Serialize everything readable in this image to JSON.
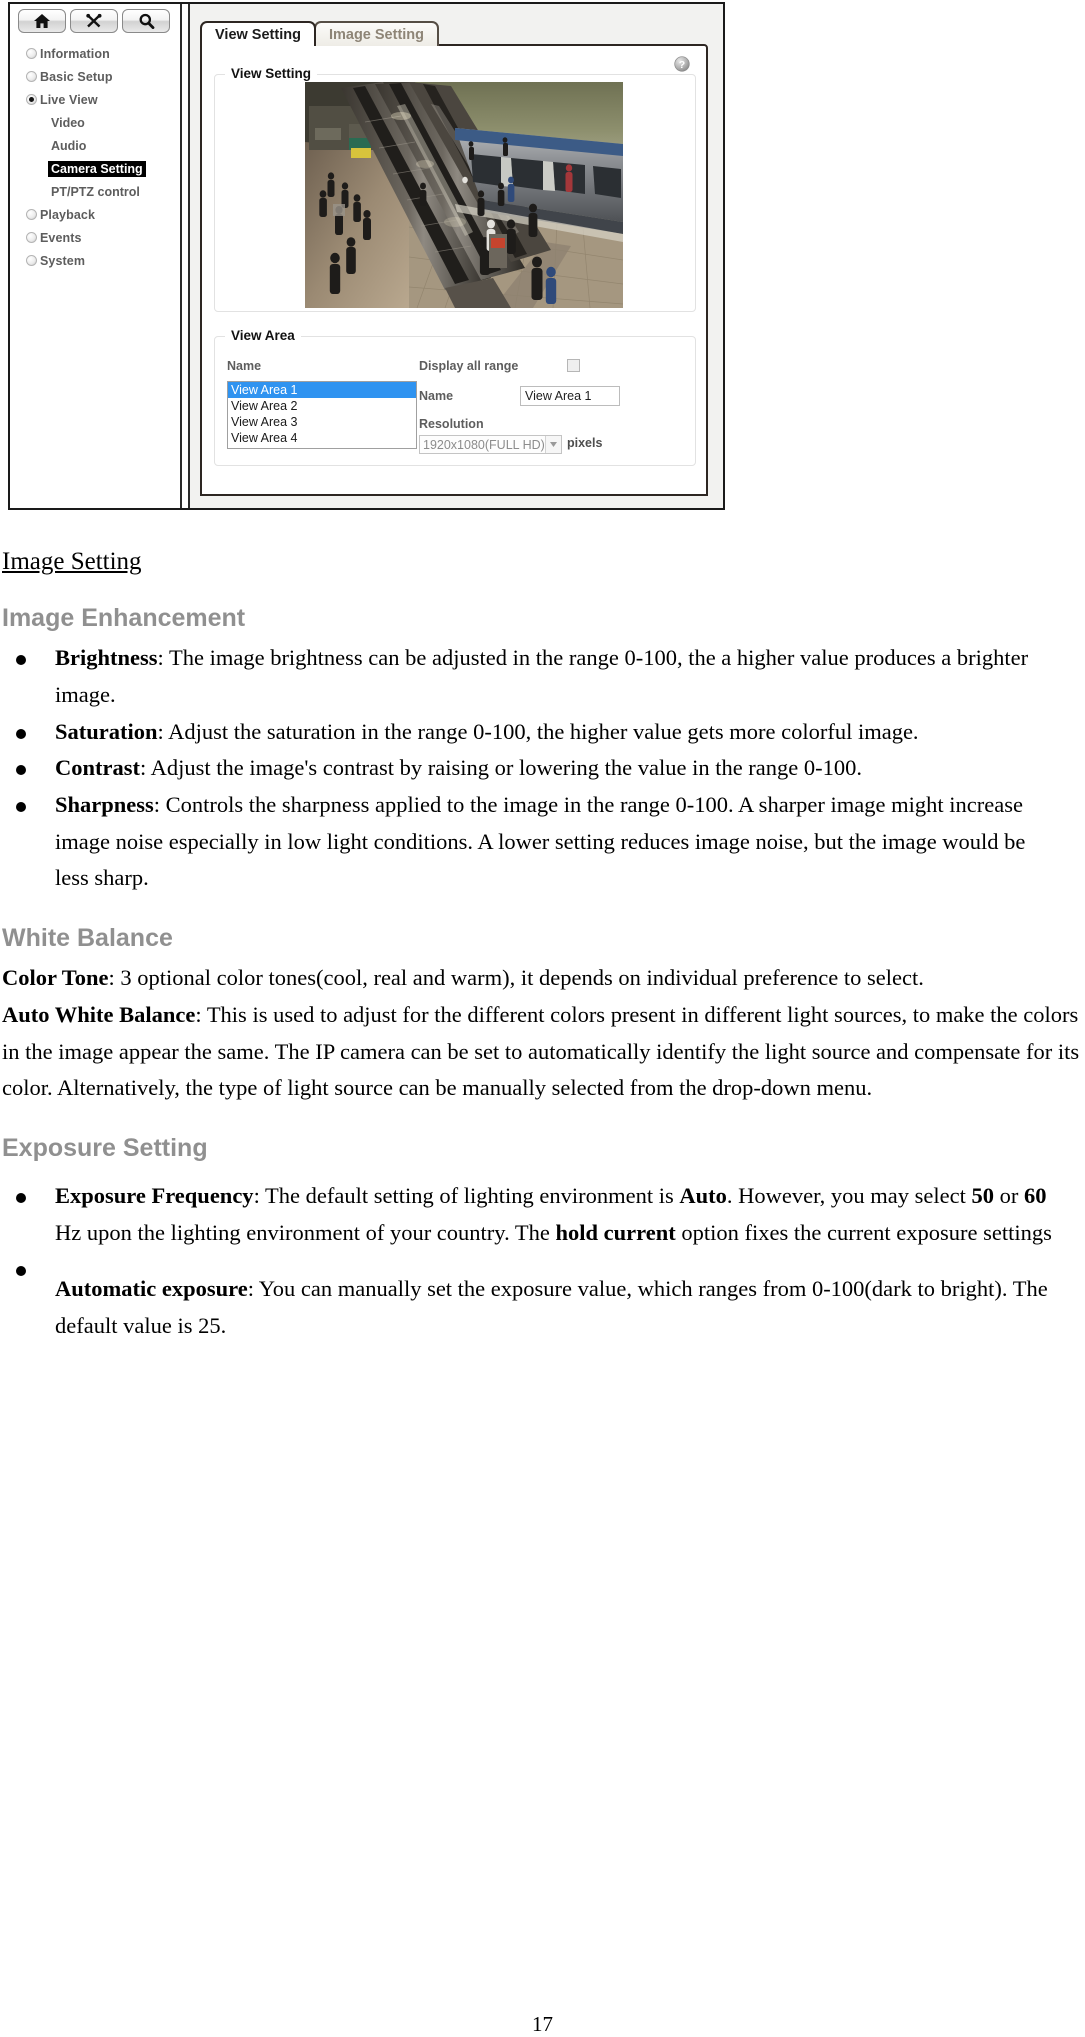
{
  "screenshot": {
    "toolbar": {
      "buttons": [
        {
          "name": "home-icon",
          "title": "Home"
        },
        {
          "name": "tools-icon",
          "title": "Tools"
        },
        {
          "name": "search-icon",
          "title": "Search"
        }
      ]
    },
    "sidebar": {
      "items": [
        {
          "label": "Information",
          "selected": false
        },
        {
          "label": "Basic Setup",
          "selected": false
        },
        {
          "label": "Live View",
          "selected": true
        },
        {
          "label": "Playback",
          "selected": false
        },
        {
          "label": "Events",
          "selected": false
        },
        {
          "label": "System",
          "selected": false
        }
      ],
      "sub_items": [
        {
          "label": "Video",
          "active": false
        },
        {
          "label": "Audio",
          "active": false
        },
        {
          "label": "Camera Setting",
          "active": true
        },
        {
          "label": "PT/PTZ control",
          "active": false
        }
      ]
    },
    "tabs": [
      {
        "label": "View Setting",
        "active": true
      },
      {
        "label": "Image Setting",
        "active": false
      }
    ],
    "help_icon": "question-mark-icon",
    "view_setting_group": {
      "legend": "View Setting",
      "preview_alt": "subway-station-camera-preview"
    },
    "view_area_group": {
      "legend": "View Area",
      "name_list_label": "Name",
      "options": [
        {
          "label": "View Area 1",
          "selected": true
        },
        {
          "label": "View Area 2",
          "selected": false
        },
        {
          "label": "View Area 3",
          "selected": false
        },
        {
          "label": "View Area 4",
          "selected": false
        }
      ],
      "display_all_range_label": "Display all range",
      "display_all_range_checked": false,
      "name_field_label": "Name",
      "name_field_value": "View Area 1",
      "resolution_label": "Resolution",
      "resolution_value": "1920x1080(FULL HD)",
      "pixels_label": "pixels"
    },
    "colors": {
      "selection_blue": "#2f93f0",
      "active_highlight": "#000000",
      "label_gray": "#5d5d5d"
    }
  },
  "document": {
    "heading": "Image Setting",
    "sections": [
      {
        "title": "Image Enhancement",
        "bullets": [
          {
            "term": "Brightness",
            "text": ": The image brightness can be adjusted in the range 0-100, the a higher value produces a brighter image."
          },
          {
            "term": "Saturation",
            "text": ": Adjust the saturation in the range 0-100, the higher value gets more colorful image."
          },
          {
            "term": "Contrast",
            "text": ": Adjust the image's contrast by raising or lowering the value in the range 0-100."
          },
          {
            "term": "Sharpness",
            "text": ": Controls the sharpness applied to the image in the range 0-100. A sharper image might increase image noise especially in low light conditions. A lower setting reduces image noise, but the image would be less sharp."
          }
        ]
      },
      {
        "title": "White Balance",
        "paragraphs": [
          {
            "term": "Color Tone",
            "text": ": 3 optional color tones(cool, real and warm), it depends on individual preference to select."
          },
          {
            "term": "Auto White Balance",
            "text": ": This is used to adjust for the different colors present in different light sources, to make the colors in the image appear the same. The IP camera can be set to automatically identify the light source and compensate for its color. Alternatively, the type of light source can be manually selected from the drop-down menu."
          }
        ]
      },
      {
        "title": "Exposure Setting",
        "bullets": [
          {
            "term": "Exposure Frequency",
            "parts": [
              {
                "t": ": The default setting of lighting environment is "
              },
              {
                "t": "Auto",
                "b": true
              },
              {
                "t": ". However, you may select "
              },
              {
                "t": "50",
                "b": true
              },
              {
                "t": " or "
              },
              {
                "t": "60",
                "b": true
              },
              {
                "t": " Hz upon the lighting environment of your country. The "
              },
              {
                "t": "hold current",
                "b": true
              },
              {
                "t": " option fixes the current exposure settings"
              }
            ]
          },
          {
            "term": "Automatic exposure",
            "text": ": You can manually set the exposure value, which ranges from 0-100(dark to bright). The default value is 25."
          }
        ]
      }
    ],
    "page_number": "17"
  }
}
